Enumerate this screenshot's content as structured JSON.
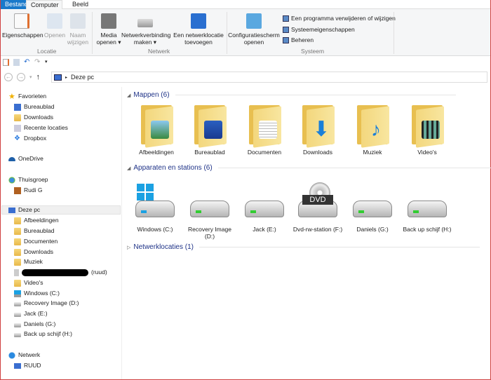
{
  "tabs": [
    "Bestand",
    "Computer",
    "Beeld"
  ],
  "ribbon": {
    "groups": [
      "Locatie",
      "Netwerk",
      "Systeem"
    ],
    "buttons": [
      "Eigenschappen",
      "Openen",
      "Naam wijzigen",
      "Media openen ▾",
      "Netwerkverbinding maken ▾",
      "Een netwerklocatie toevoegen",
      "Configuratiescherm openen"
    ],
    "small": [
      "Een programma verwijderen of wijzigen",
      "Systeemeigenschappen",
      "Beheren"
    ]
  },
  "address": {
    "path": "Deze pc"
  },
  "nav": {
    "favorites": "Favorieten",
    "fav_items": [
      "Bureaublad",
      "Downloads",
      "Recente locaties",
      "Dropbox"
    ],
    "onedrive": "OneDrive",
    "homegroup": "Thuisgroep",
    "home_items": [
      "Rudi G"
    ],
    "thispc": "Deze pc",
    "pc_items": [
      "Afbeeldingen",
      "Bureaublad",
      "Documenten",
      "Downloads",
      "Muziek"
    ],
    "redacted_suffix": "(ruud)",
    "pc_items2": [
      "Video's",
      "Windows (C:)",
      "Recovery Image (D:)",
      "Jack (E:)",
      "Daniels (G:)",
      "Back up schijf (H:)"
    ],
    "network": "Netwerk",
    "net_items": [
      "RUUD"
    ]
  },
  "content": {
    "folders_header": "Mappen (6)",
    "folders": [
      "Afbeeldingen",
      "Bureaublad",
      "Documenten",
      "Downloads",
      "Muziek",
      "Video's"
    ],
    "devices_header": "Apparaten en stations (6)",
    "devices": [
      "Windows (C:)",
      "Recovery Image (D:)",
      "Jack (E:)",
      "Dvd-rw-station (F:)",
      "Daniels (G:)",
      "Back up schijf (H:)"
    ],
    "dvd_label": "DVD",
    "network_header": "Netwerklocaties (1)"
  }
}
